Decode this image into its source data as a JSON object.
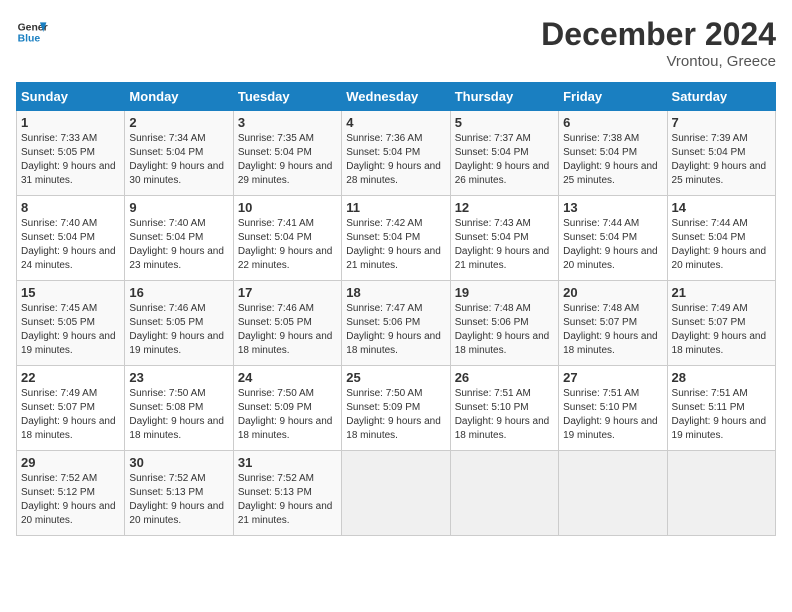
{
  "logo": {
    "line1": "General",
    "line2": "Blue"
  },
  "title": "December 2024",
  "subtitle": "Vrontou, Greece",
  "days_header": [
    "Sunday",
    "Monday",
    "Tuesday",
    "Wednesday",
    "Thursday",
    "Friday",
    "Saturday"
  ],
  "weeks": [
    [
      {
        "day": "1",
        "sunrise": "Sunrise: 7:33 AM",
        "sunset": "Sunset: 5:05 PM",
        "daylight": "Daylight: 9 hours and 31 minutes."
      },
      {
        "day": "2",
        "sunrise": "Sunrise: 7:34 AM",
        "sunset": "Sunset: 5:04 PM",
        "daylight": "Daylight: 9 hours and 30 minutes."
      },
      {
        "day": "3",
        "sunrise": "Sunrise: 7:35 AM",
        "sunset": "Sunset: 5:04 PM",
        "daylight": "Daylight: 9 hours and 29 minutes."
      },
      {
        "day": "4",
        "sunrise": "Sunrise: 7:36 AM",
        "sunset": "Sunset: 5:04 PM",
        "daylight": "Daylight: 9 hours and 28 minutes."
      },
      {
        "day": "5",
        "sunrise": "Sunrise: 7:37 AM",
        "sunset": "Sunset: 5:04 PM",
        "daylight": "Daylight: 9 hours and 26 minutes."
      },
      {
        "day": "6",
        "sunrise": "Sunrise: 7:38 AM",
        "sunset": "Sunset: 5:04 PM",
        "daylight": "Daylight: 9 hours and 25 minutes."
      },
      {
        "day": "7",
        "sunrise": "Sunrise: 7:39 AM",
        "sunset": "Sunset: 5:04 PM",
        "daylight": "Daylight: 9 hours and 25 minutes."
      }
    ],
    [
      {
        "day": "8",
        "sunrise": "Sunrise: 7:40 AM",
        "sunset": "Sunset: 5:04 PM",
        "daylight": "Daylight: 9 hours and 24 minutes."
      },
      {
        "day": "9",
        "sunrise": "Sunrise: 7:40 AM",
        "sunset": "Sunset: 5:04 PM",
        "daylight": "Daylight: 9 hours and 23 minutes."
      },
      {
        "day": "10",
        "sunrise": "Sunrise: 7:41 AM",
        "sunset": "Sunset: 5:04 PM",
        "daylight": "Daylight: 9 hours and 22 minutes."
      },
      {
        "day": "11",
        "sunrise": "Sunrise: 7:42 AM",
        "sunset": "Sunset: 5:04 PM",
        "daylight": "Daylight: 9 hours and 21 minutes."
      },
      {
        "day": "12",
        "sunrise": "Sunrise: 7:43 AM",
        "sunset": "Sunset: 5:04 PM",
        "daylight": "Daylight: 9 hours and 21 minutes."
      },
      {
        "day": "13",
        "sunrise": "Sunrise: 7:44 AM",
        "sunset": "Sunset: 5:04 PM",
        "daylight": "Daylight: 9 hours and 20 minutes."
      },
      {
        "day": "14",
        "sunrise": "Sunrise: 7:44 AM",
        "sunset": "Sunset: 5:04 PM",
        "daylight": "Daylight: 9 hours and 20 minutes."
      }
    ],
    [
      {
        "day": "15",
        "sunrise": "Sunrise: 7:45 AM",
        "sunset": "Sunset: 5:05 PM",
        "daylight": "Daylight: 9 hours and 19 minutes."
      },
      {
        "day": "16",
        "sunrise": "Sunrise: 7:46 AM",
        "sunset": "Sunset: 5:05 PM",
        "daylight": "Daylight: 9 hours and 19 minutes."
      },
      {
        "day": "17",
        "sunrise": "Sunrise: 7:46 AM",
        "sunset": "Sunset: 5:05 PM",
        "daylight": "Daylight: 9 hours and 18 minutes."
      },
      {
        "day": "18",
        "sunrise": "Sunrise: 7:47 AM",
        "sunset": "Sunset: 5:06 PM",
        "daylight": "Daylight: 9 hours and 18 minutes."
      },
      {
        "day": "19",
        "sunrise": "Sunrise: 7:48 AM",
        "sunset": "Sunset: 5:06 PM",
        "daylight": "Daylight: 9 hours and 18 minutes."
      },
      {
        "day": "20",
        "sunrise": "Sunrise: 7:48 AM",
        "sunset": "Sunset: 5:07 PM",
        "daylight": "Daylight: 9 hours and 18 minutes."
      },
      {
        "day": "21",
        "sunrise": "Sunrise: 7:49 AM",
        "sunset": "Sunset: 5:07 PM",
        "daylight": "Daylight: 9 hours and 18 minutes."
      }
    ],
    [
      {
        "day": "22",
        "sunrise": "Sunrise: 7:49 AM",
        "sunset": "Sunset: 5:07 PM",
        "daylight": "Daylight: 9 hours and 18 minutes."
      },
      {
        "day": "23",
        "sunrise": "Sunrise: 7:50 AM",
        "sunset": "Sunset: 5:08 PM",
        "daylight": "Daylight: 9 hours and 18 minutes."
      },
      {
        "day": "24",
        "sunrise": "Sunrise: 7:50 AM",
        "sunset": "Sunset: 5:09 PM",
        "daylight": "Daylight: 9 hours and 18 minutes."
      },
      {
        "day": "25",
        "sunrise": "Sunrise: 7:50 AM",
        "sunset": "Sunset: 5:09 PM",
        "daylight": "Daylight: 9 hours and 18 minutes."
      },
      {
        "day": "26",
        "sunrise": "Sunrise: 7:51 AM",
        "sunset": "Sunset: 5:10 PM",
        "daylight": "Daylight: 9 hours and 18 minutes."
      },
      {
        "day": "27",
        "sunrise": "Sunrise: 7:51 AM",
        "sunset": "Sunset: 5:10 PM",
        "daylight": "Daylight: 9 hours and 19 minutes."
      },
      {
        "day": "28",
        "sunrise": "Sunrise: 7:51 AM",
        "sunset": "Sunset: 5:11 PM",
        "daylight": "Daylight: 9 hours and 19 minutes."
      }
    ],
    [
      {
        "day": "29",
        "sunrise": "Sunrise: 7:52 AM",
        "sunset": "Sunset: 5:12 PM",
        "daylight": "Daylight: 9 hours and 20 minutes."
      },
      {
        "day": "30",
        "sunrise": "Sunrise: 7:52 AM",
        "sunset": "Sunset: 5:13 PM",
        "daylight": "Daylight: 9 hours and 20 minutes."
      },
      {
        "day": "31",
        "sunrise": "Sunrise: 7:52 AM",
        "sunset": "Sunset: 5:13 PM",
        "daylight": "Daylight: 9 hours and 21 minutes."
      },
      null,
      null,
      null,
      null
    ]
  ]
}
